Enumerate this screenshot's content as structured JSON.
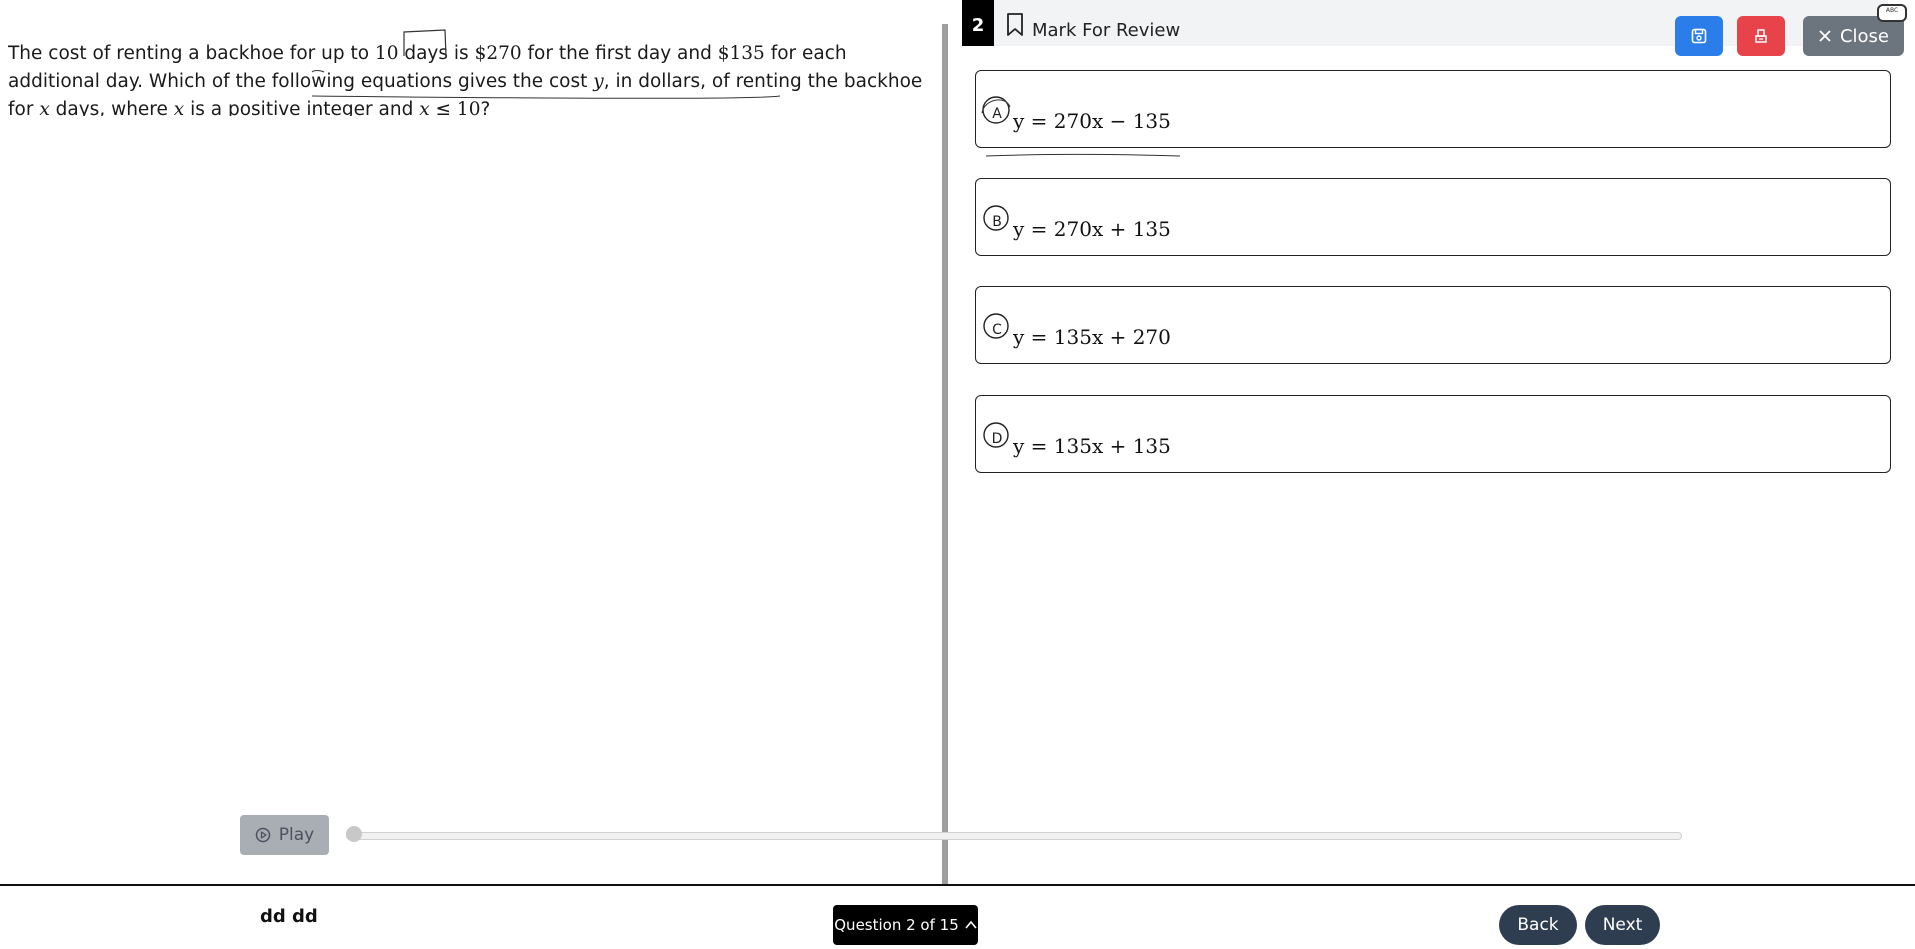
{
  "passage": {
    "s1": "The cost of renting a backhoe for up to ",
    "n1": "10",
    "s2": " days is ",
    "n2": "$270",
    "s3": " for the first day and ",
    "n3": "$135",
    "s4": " for each additional day. Which of the following equations gives the cost ",
    "v1": "y",
    "s5": ", in dollars, of renting the backhoe for ",
    "v2": "x",
    "s6": " days, where ",
    "v3": "x",
    "s7": " is a positive integer and ",
    "v4": "x",
    "s8": " ≤ ",
    "n4": "10",
    "s9": "?"
  },
  "header": {
    "question_number": "2",
    "mark_review_label": "Mark For Review",
    "close_label": "Close",
    "corner_widget_text": "ABC"
  },
  "choices": [
    {
      "letter": "A",
      "expr": "y = 270x − 135"
    },
    {
      "letter": "B",
      "expr": "y = 270x + 135"
    },
    {
      "letter": "C",
      "expr": "y = 135x + 270"
    },
    {
      "letter": "D",
      "expr": "y = 135x + 135"
    }
  ],
  "player": {
    "play_label": "Play",
    "progress": 0
  },
  "footer": {
    "student_name": "dd dd",
    "question_nav_label": "Question 2 of 15",
    "back_label": "Back",
    "next_label": "Next"
  },
  "colors": {
    "save": "#2b7de9",
    "erase": "#e8424a",
    "close": "#6c757d",
    "nav": "#2f3d50"
  },
  "icons": [
    "bookmark-icon",
    "save-icon",
    "eraser-icon",
    "close-icon",
    "play-circle-icon",
    "chevron-up-icon"
  ]
}
